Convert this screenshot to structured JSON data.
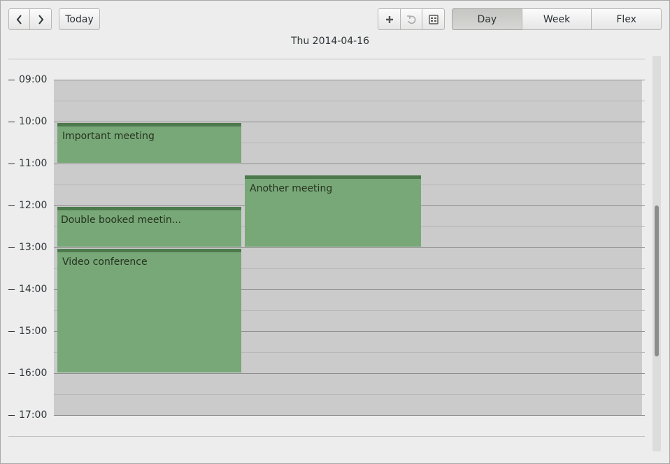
{
  "toolbar": {
    "prev_icon": "chevron-left-icon",
    "next_icon": "chevron-right-icon",
    "today_label": "Today",
    "add_icon": "plus-icon",
    "undo_icon": "undo-icon",
    "calendar_icon": "calendar-icon",
    "views": [
      {
        "label": "Day",
        "active": true
      },
      {
        "label": "Week",
        "active": false
      },
      {
        "label": "Flex",
        "active": false
      }
    ]
  },
  "date_title": "Thu 2014-04-16",
  "hours": [
    "09:00",
    "10:00",
    "11:00",
    "12:00",
    "13:00",
    "14:00",
    "15:00",
    "16:00",
    "17:00"
  ],
  "events": [
    {
      "title": "Important meeting"
    },
    {
      "title": "Another meeting"
    },
    {
      "title": "Double booked meetin..."
    },
    {
      "title": "Video conference"
    }
  ],
  "colors": {
    "event_fill": "#78a878",
    "event_top_bar": "#4d7a4d",
    "grid_background": "#cbcbcb",
    "window_background": "#ededed"
  }
}
